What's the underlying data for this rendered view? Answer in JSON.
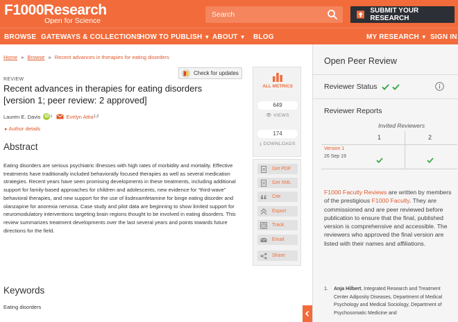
{
  "header": {
    "logo_main": "F1000Research",
    "logo_sub": "Open for Science",
    "search_placeholder": "Search",
    "submit_label": "SUBMIT YOUR RESEARCH"
  },
  "nav": {
    "browse": "BROWSE",
    "gateways": "GATEWAYS & COLLECTIONS",
    "how_to_publish": "HOW TO PUBLISH",
    "about": "ABOUT",
    "blog": "BLOG",
    "my_research": "MY RESEARCH",
    "sign_in": "SIGN IN",
    "caret": "▼"
  },
  "breadcrumb": {
    "home": "Home",
    "browse": "Browse",
    "current": "Recent advances in therapies for eating disorders",
    "separator": "»"
  },
  "article": {
    "check_updates": "Check for updates",
    "type": "REVIEW",
    "title": "Recent advances in therapies for eating disorders [version 1; peer review: 2 approved]",
    "author1": "Lauren E. Davis",
    "author1_sup": "1",
    "author2": "Evelyn Attia",
    "author2_sup": "1,2",
    "orcid": "iD",
    "author_details": "Author details",
    "abstract_heading": "Abstract",
    "abstract": "Eating disorders are serious psychiatric illnesses with high rates of morbidity and mortality. Effective treatments have traditionally included behaviorally focused therapies as well as several medication strategies. Recent years have seen promising developments in these treatments, including additional support for family-based approaches for children and adolescents, new evidence for “third-wave” behavioral therapies, and new support for the use of lisdexamfetamine for binge eating disorder and olanzapine for anorexia nervosa. Case study and pilot data are beginning to show limited support for neuromodulatory interventions targeting brain regions thought to be involved in eating disorders. This review summarizes treatment developments over the last several years and points towards future directions for the field.",
    "keywords_heading": "Keywords",
    "keywords": "Eating disorders"
  },
  "metrics": {
    "all_metrics": "ALL METRICS",
    "views_count": "649",
    "views_label": "VIEWS",
    "downloads_count": "174",
    "downloads_label": "DOWNLOADS"
  },
  "tools": {
    "get_pdf": "Get PDF",
    "get_xml": "Get XML",
    "cite": "Cite",
    "export": "Export",
    "track": "Track",
    "email": "Email",
    "share": "Share"
  },
  "peer_review": {
    "title": "Open Peer Review",
    "reviewer_status": "Reviewer Status",
    "reviewer_reports": "Reviewer Reports",
    "invited": "Invited Reviewers",
    "reviewer_1": "1",
    "reviewer_2": "2",
    "version": "Version 1",
    "version_date": "26 Sep 19",
    "faculty_link1": "F1000 Faculty Reviews",
    "faculty_mid1": " are written by members of the prestigious ",
    "faculty_link2": "F1000 Faculty",
    "faculty_rest": ". They are commissioned and are peer reviewed before publication to ensure that the final, published version is comprehensive and accessible. The reviewers who approved the final version are listed with their names and affiliations.",
    "reviewer_item_num": "1.",
    "reviewer_item_name": "Anja Hilbert",
    "reviewer_item_affil": ", Integrated Research and Treatment Center Adiposity Diseases, Department of Medical Psychology and Medical Sociology, Department of Psychosomatic Medicine and"
  },
  "colors": {
    "brand": "#f26b3a",
    "dark_button": "#2c2f35",
    "approved": "#3aa84a",
    "panel_bg": "#f5f5f5"
  }
}
